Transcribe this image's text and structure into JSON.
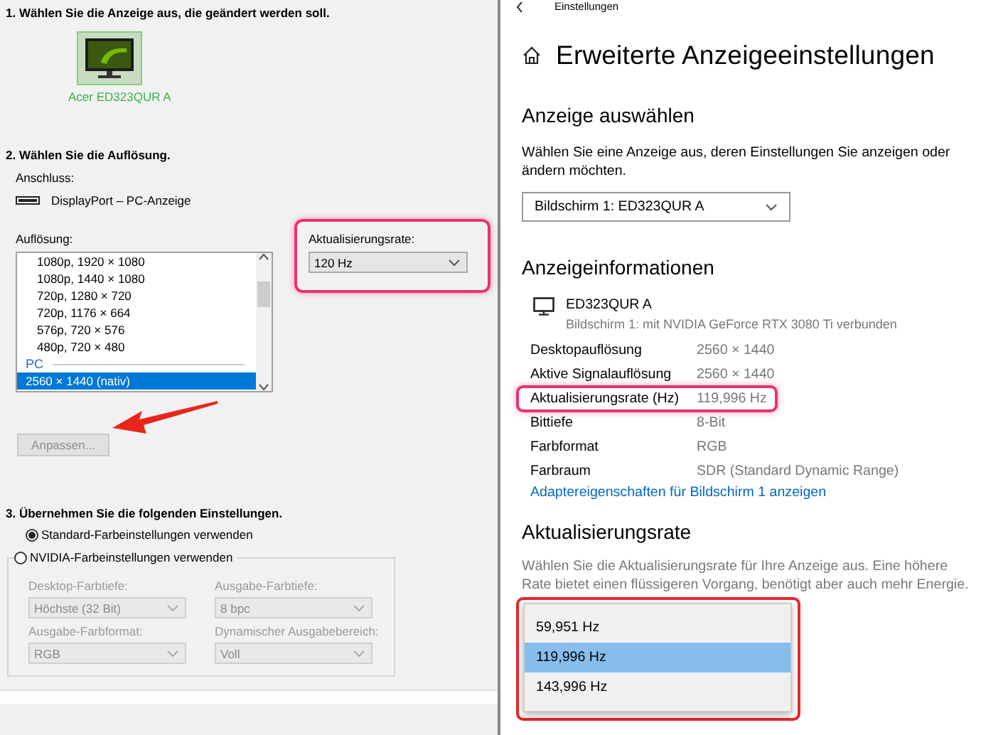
{
  "nvidia_panel": {
    "step1": {
      "heading": "1. Wählen Sie die Anzeige aus, die geändert werden soll.",
      "display": {
        "label": "Acer ED323QUR A",
        "selected": true
      }
    },
    "step2": {
      "heading": "2. Wählen Sie die Auflösung.",
      "connection_label": "Anschluss:",
      "connection": "DisplayPort – PC-Anzeige",
      "resolution_label": "Auflösung:",
      "resolutions": [
        {
          "kind": "item",
          "label": "1080p, 1920 × 1080",
          "selected": false
        },
        {
          "kind": "item",
          "label": "1080p, 1440 × 1080",
          "selected": false
        },
        {
          "kind": "item",
          "label": "720p, 1280 × 720",
          "selected": false
        },
        {
          "kind": "item",
          "label": "720p, 1176 × 664",
          "selected": false
        },
        {
          "kind": "item",
          "label": "576p, 720 × 576",
          "selected": false
        },
        {
          "kind": "item",
          "label": "480p, 720 × 480",
          "selected": false
        },
        {
          "kind": "group",
          "label": "PC"
        },
        {
          "kind": "item",
          "label": "2560 × 1440 (nativ)",
          "selected": true
        }
      ],
      "refresh_label": "Aktualisierungsrate:",
      "refresh_value": "120 Hz",
      "customize_button": {
        "label": "Anpassen...",
        "disabled": true
      }
    },
    "step3": {
      "heading": "3. Übernehmen Sie die folgenden Einstellungen.",
      "options": [
        {
          "label": "Standard-Farbeinstellungen verwenden",
          "selected": true
        },
        {
          "label": "NVIDIA-Farbeinstellungen verwenden",
          "selected": false
        }
      ],
      "fields": [
        {
          "label": "Desktop-Farbtiefe:",
          "value": "Höchste (32 Bit)",
          "disabled": true
        },
        {
          "label": "Ausgabe-Farbtiefe:",
          "value": "8 bpc",
          "disabled": true
        },
        {
          "label": "Ausgabe-Farbformat:",
          "value": "RGB",
          "disabled": true
        },
        {
          "label": "Dynamischer Ausgabebereich:",
          "value": "Voll",
          "disabled": true
        }
      ]
    }
  },
  "settings": {
    "breadcrumb": "Einstellungen",
    "title": "Erweiterte Anzeigeeinstellungen",
    "select_heading": "Anzeige auswählen",
    "select_description": "Wählen Sie eine Anzeige aus, deren Einstellungen Sie anzeigen oder ändern möchten.",
    "display_dropdown": "Bildschirm 1: ED323QUR A",
    "info_heading": "Anzeigeinformationen",
    "monitor_name": "ED323QUR A",
    "monitor_subtitle": "Bildschirm 1: mit NVIDIA GeForce RTX 3080 Ti verbunden",
    "info_rows": [
      {
        "label": "Desktopauflösung",
        "value": "2560 × 1440"
      },
      {
        "label": "Aktive Signalauflösung",
        "value": "2560 × 1440"
      },
      {
        "label": "Aktualisierungsrate (Hz)",
        "value": "119,996 Hz"
      },
      {
        "label": "Bittiefe",
        "value": "8-Bit"
      },
      {
        "label": "Farbformat",
        "value": "RGB"
      },
      {
        "label": "Farbraum",
        "value": "SDR (Standard Dynamic Range)"
      }
    ],
    "adapter_link": "Adaptereigenschaften für Bildschirm 1 anzeigen",
    "refresh_heading": "Aktualisierungsrate",
    "refresh_description": "Wählen Sie die Aktualisierungsrate für Ihre Anzeige aus. Eine höhere Rate bietet einen flüssigeren Vorgang, benötigt aber auch mehr Energie.",
    "refresh_options": [
      {
        "label": "59,951 Hz",
        "selected": false
      },
      {
        "label": "119,996 Hz",
        "selected": true
      },
      {
        "label": "143,996 Hz",
        "selected": false
      }
    ]
  }
}
